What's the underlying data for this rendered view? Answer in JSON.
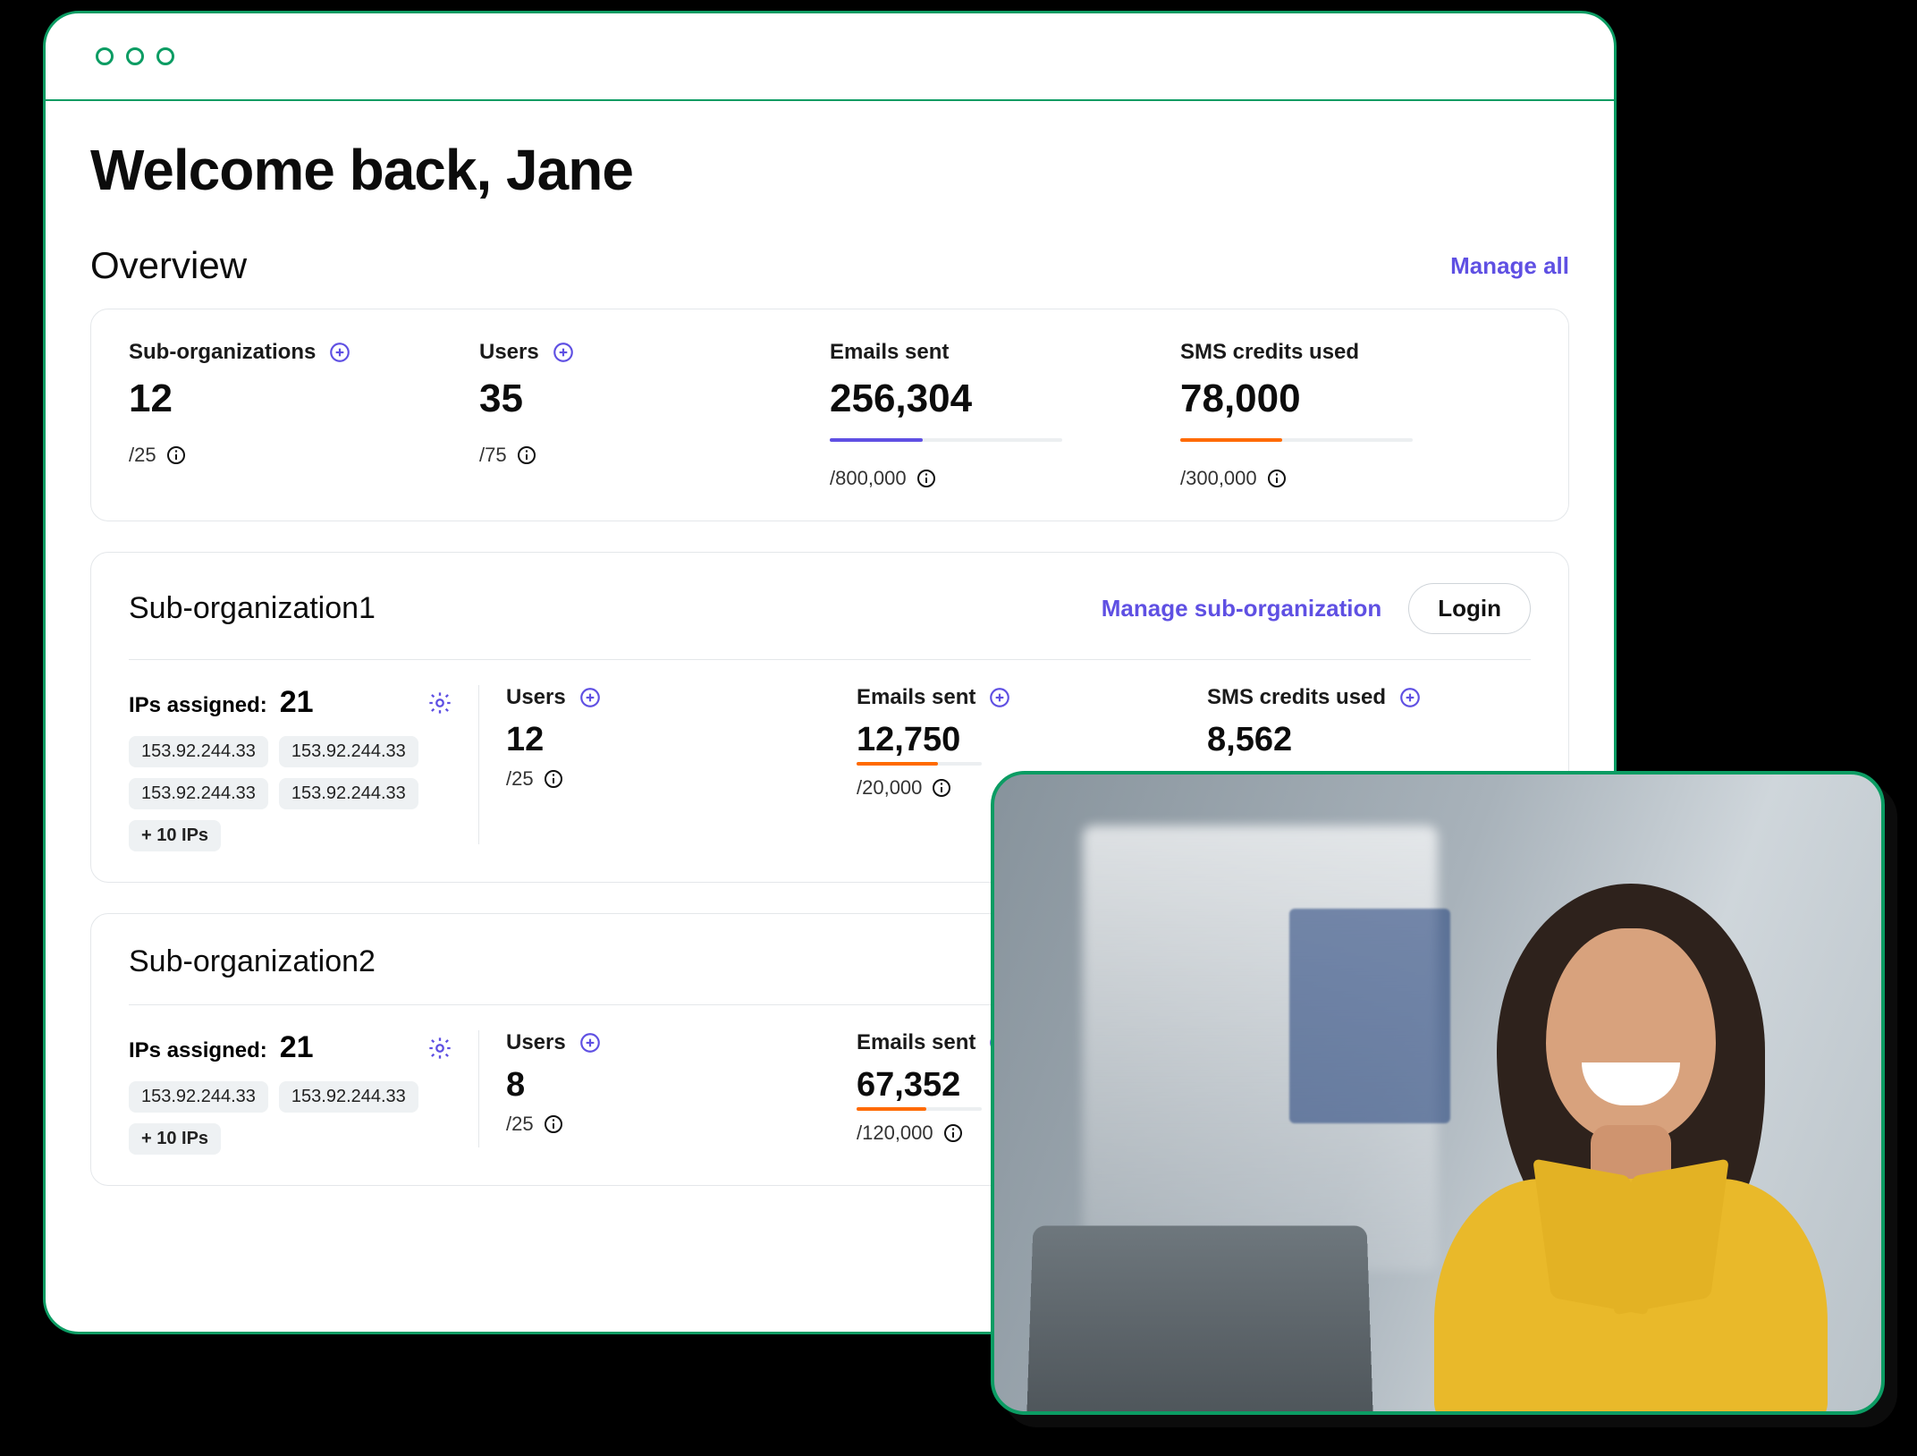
{
  "header": {
    "welcome": "Welcome back, Jane"
  },
  "overview": {
    "title": "Overview",
    "manage_all": "Manage all",
    "stats": [
      {
        "label": "Sub-organizations",
        "value": "12",
        "limit": "/25",
        "add": true,
        "bar": null
      },
      {
        "label": "Users",
        "value": "35",
        "limit": "/75",
        "add": true,
        "bar": null
      },
      {
        "label": "Emails sent",
        "value": "256,304",
        "limit": "/800,000",
        "add": false,
        "bar": {
          "color": "purple",
          "pct": 40
        }
      },
      {
        "label": "SMS credits used",
        "value": "78,000",
        "limit": "/300,000",
        "add": false,
        "bar": {
          "color": "orange",
          "pct": 44
        }
      }
    ]
  },
  "suborgs": [
    {
      "title": "Sub-organization1",
      "manage_label": "Manage sub-organization",
      "login_label": "Login",
      "show_actions": true,
      "ips": {
        "label": "IPs assigned:",
        "count": "21",
        "list": [
          "153.92.244.33",
          "153.92.244.33",
          "153.92.244.33",
          "153.92.244.33"
        ],
        "more": "+ 10 IPs"
      },
      "cols": [
        {
          "label": "Users",
          "value": "12",
          "limit": "/25",
          "bar": null
        },
        {
          "label": "Emails sent",
          "value": "12,750",
          "limit": "/20,000",
          "bar": {
            "color": "orange",
            "pct": 65
          }
        },
        {
          "label": "SMS credits used",
          "value": "8,562",
          "limit": "",
          "bar": null
        }
      ]
    },
    {
      "title": "Sub-organization2",
      "manage_label": "",
      "login_label": "",
      "show_actions": false,
      "ips": {
        "label": "IPs assigned:",
        "count": "21",
        "list": [
          "153.92.244.33",
          "153.92.244.33"
        ],
        "more": "+ 10 IPs"
      },
      "cols": [
        {
          "label": "Users",
          "value": "8",
          "limit": "/25",
          "bar": null
        },
        {
          "label": "Emails sent",
          "value": "67,352",
          "limit": "/120,000",
          "bar": {
            "color": "orange",
            "pct": 56
          }
        }
      ]
    }
  ],
  "colors": {
    "accent": "#5f50e3",
    "brand": "#0b9c63",
    "orange": "#ff6a00"
  }
}
